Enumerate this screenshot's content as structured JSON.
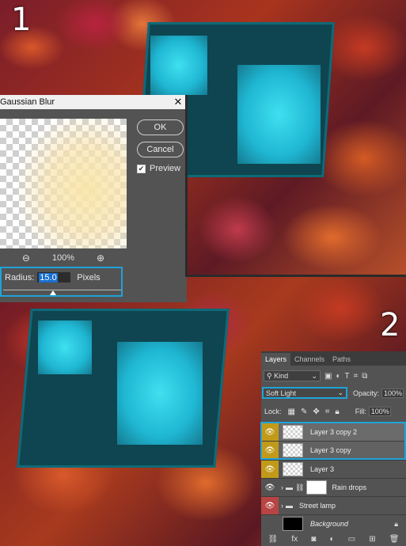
{
  "step_numbers": [
    "1",
    "2"
  ],
  "dialog": {
    "title": "Gaussian Blur",
    "close_glyph": "✕",
    "ok_label": "OK",
    "cancel_label": "Cancel",
    "preview_label": "Preview",
    "preview_checked": true,
    "zoom_out_icon": "zoom-out-icon",
    "zoom_level": "100%",
    "zoom_in_icon": "zoom-in-icon",
    "radius_label": "Radius:",
    "radius_value": "15.0",
    "radius_unit": "Pixels"
  },
  "layers_panel": {
    "tabs": [
      "Layers",
      "Channels",
      "Paths"
    ],
    "active_tab": "Layers",
    "filter_kind": "Kind",
    "blend_mode": "Soft Light",
    "opacity_label": "Opacity:",
    "opacity_value": "100%",
    "lock_label": "Lock:",
    "fill_label": "Fill:",
    "fill_value": "100%",
    "layers": [
      {
        "name": "Layer 3 copy 2",
        "visible_marker": "gold",
        "thumb": "transparent",
        "selected": true
      },
      {
        "name": "Layer 3 copy",
        "visible_marker": "gold",
        "thumb": "transparent",
        "selected": true
      },
      {
        "name": "Layer 3",
        "visible_marker": "gold",
        "thumb": "transparent",
        "selected": false
      },
      {
        "name": "Rain drops",
        "visible_marker": "none",
        "thumb": "mask",
        "group": true
      },
      {
        "name": "Street lamp",
        "visible_marker": "red",
        "thumb": "folder",
        "group": true
      },
      {
        "name": "Background",
        "visible_marker": "off",
        "thumb": "black",
        "locked": true
      }
    ]
  },
  "colors": {
    "highlight": "#1fa3d9",
    "panel_bg": "#535353",
    "lantern_glass": "#2fcbe3",
    "eye_gold": "#c19a1a",
    "eye_red": "#b84444"
  }
}
